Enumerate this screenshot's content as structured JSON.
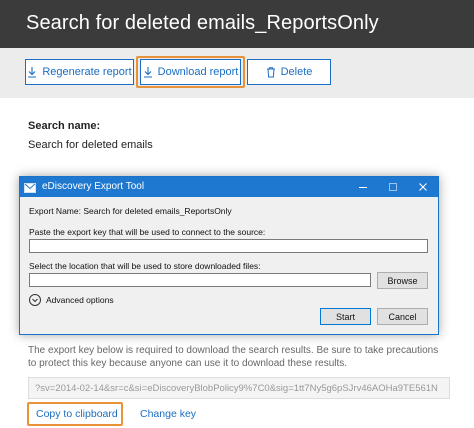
{
  "header": {
    "title": "Search for deleted emails_ReportsOnly"
  },
  "toolbar": {
    "regenerate_label": "Regenerate report",
    "download_label": "Download report",
    "delete_label": "Delete"
  },
  "details": {
    "search_name_label": "Search name:",
    "search_name_value": "Search for deleted emails"
  },
  "dialog": {
    "title": "eDiscovery Export Tool",
    "export_name": "Export Name: Search for deleted emails_ReportsOnly",
    "key_prompt": "Paste the export key that will be used to connect to the source:",
    "key_value": "",
    "location_prompt": "Select the location that will be used to store downloaded files:",
    "location_value": "",
    "browse_label": "Browse",
    "advanced_label": "Advanced options",
    "start_label": "Start",
    "cancel_label": "Cancel"
  },
  "export_key": {
    "notice": "The export key below is required to download the search results. Be sure to take precautions to protect this key because anyone can use it to download these results.",
    "value": "?sv=2014-02-14&sr=c&si=eDiscoveryBlobPolicy9%7C0&sig=1tt7Ny5g6pSJrv46AOHa9TE561N",
    "copy_label": "Copy to clipboard",
    "change_label": "Change key"
  },
  "colors": {
    "header_bg": "#3b3b3b",
    "accent": "#1b6ec2",
    "highlight": "#e8933a",
    "dialog_title_bg": "#1f78cf"
  }
}
